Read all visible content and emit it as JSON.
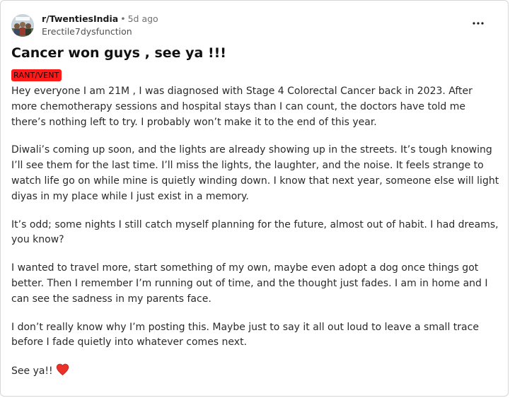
{
  "post": {
    "subreddit": "r/TwentiesIndia",
    "age": "5d ago",
    "author": "Erectile7dysfunction",
    "title": "Cancer won guys , see ya !!!",
    "flair": "RANT/VENT",
    "paragraphs": [
      "Hey everyone I am 21M , I was diagnosed with Stage 4 Colorectal Cancer back in 2023. After more chemotherapy sessions and hospital stays than I can count, the doctors have told me there’s nothing left to try. I probably won’t make it to the end of this year.",
      "Diwali’s coming up soon, and the lights are already showing up in the streets. It’s tough knowing I’ll see them for the last time. I’ll miss the lights, the laughter, and the noise. It feels strange to watch life go on while mine is quietly winding down. I know that next year, someone else will light diyas in my place while I just exist in a memory.",
      "It’s odd; some nights I still catch myself planning for the future, almost out of habit. I had dreams, you know?",
      "I wanted to travel more, start something of my own, maybe even adopt a dog once things got better. Then I remember I’m running out of time, and the thought just fades. I am in home and I can see the sadness in my parents face.",
      "I don’t really know why I’m posting this. Maybe just to say it all out loud to leave a small trace before I fade quietly into whatever comes next.",
      "See ya!!"
    ],
    "closing_emoji": "heart-icon"
  },
  "colors": {
    "flair_bg": "#ff1a1a",
    "heart": "#e8322a"
  }
}
